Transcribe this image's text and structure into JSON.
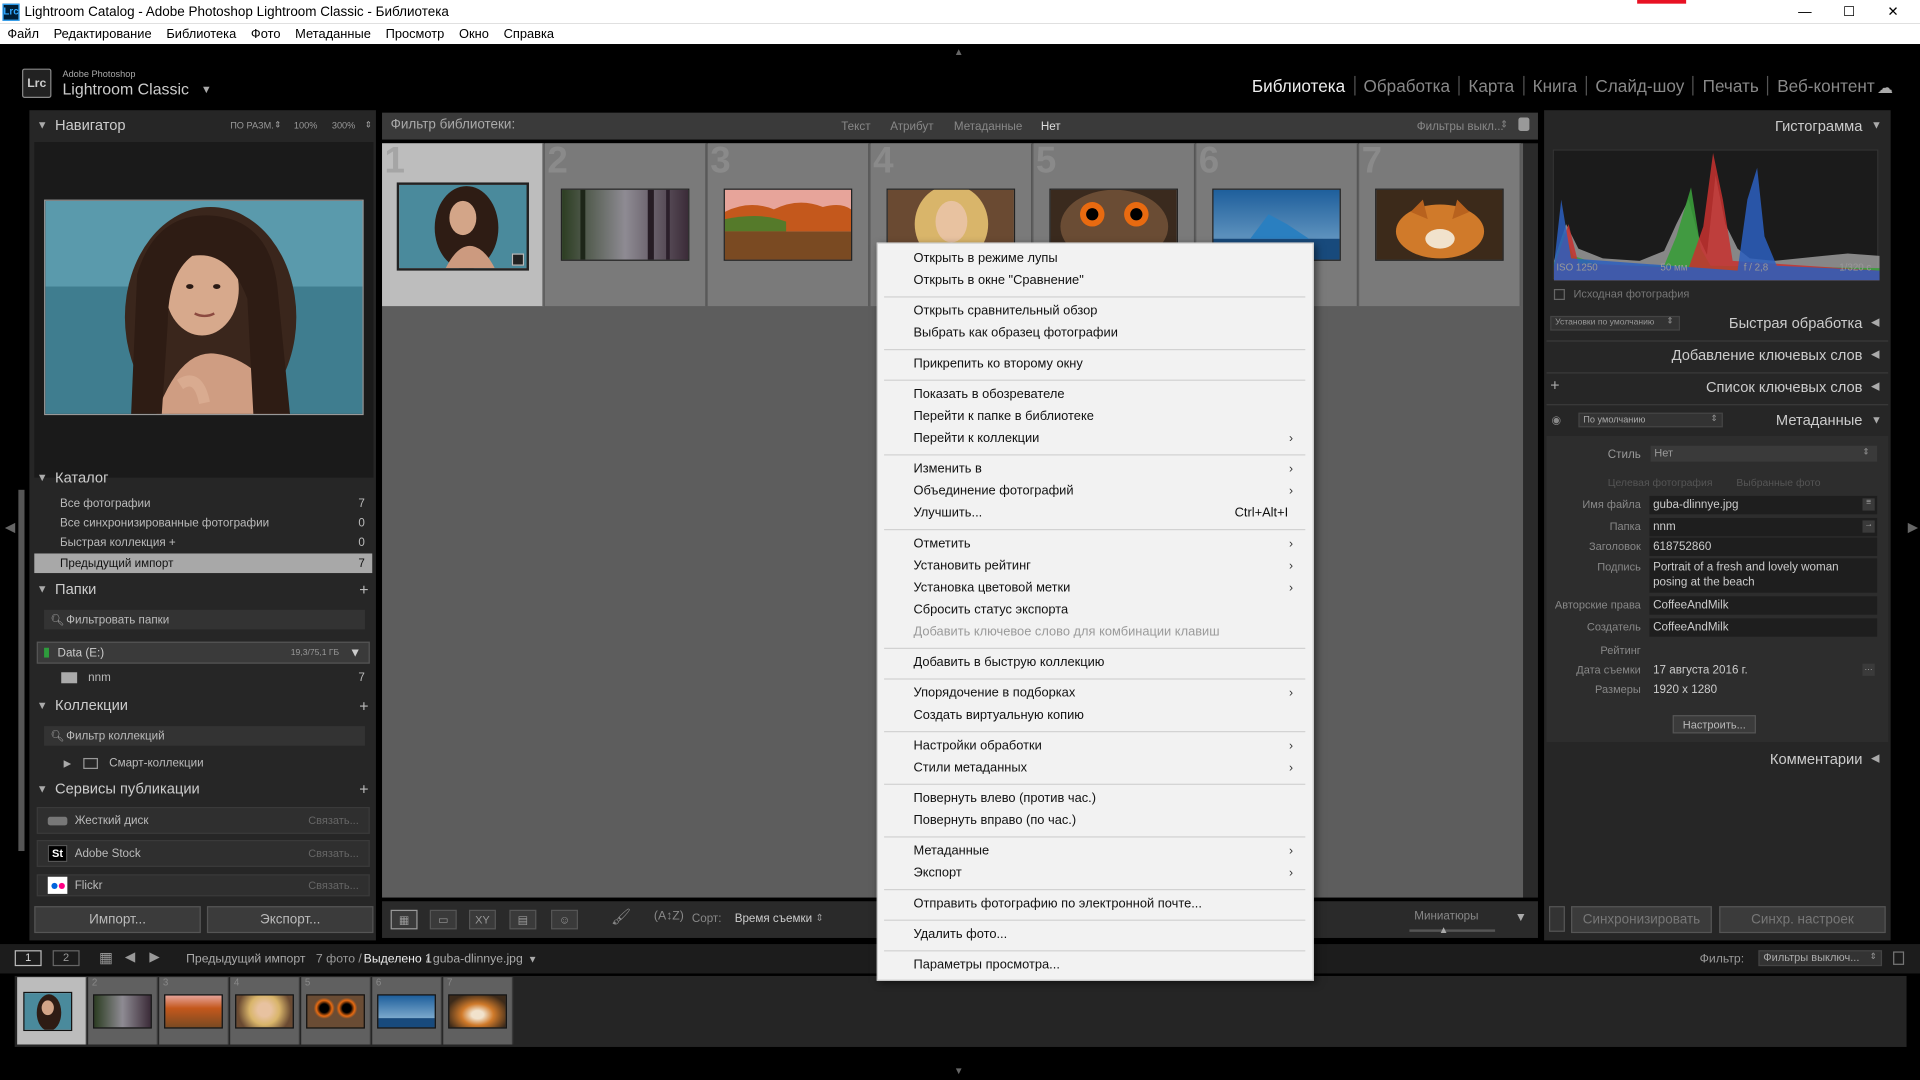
{
  "window": {
    "title": "Lightroom Catalog - Adobe Photoshop Lightroom Classic - Библиотека",
    "icon": "Lrc",
    "controls": [
      "—",
      "☐",
      "✕"
    ]
  },
  "menubar": [
    "Файл",
    "Редактирование",
    "Библиотека",
    "Фото",
    "Метаданные",
    "Просмотр",
    "Окно",
    "Справка"
  ],
  "brand": {
    "small": "Adobe Photoshop",
    "big": "Lightroom Classic",
    "logo": "Lrc"
  },
  "modules": [
    {
      "label": "Библиотека",
      "active": true
    },
    {
      "label": "Обработка"
    },
    {
      "label": "Карта"
    },
    {
      "label": "Книга"
    },
    {
      "label": "Слайд-шоу"
    },
    {
      "label": "Печать"
    },
    {
      "label": "Веб-контент"
    }
  ],
  "navigator": {
    "title": "Навигатор",
    "fit": "ПО РАЗМ.",
    "z1": "100%",
    "z2": "300%"
  },
  "catalog": {
    "title": "Каталог",
    "rows": [
      {
        "label": "Все фотографии",
        "count": "7"
      },
      {
        "label": "Все синхронизированные фотографии",
        "count": "0"
      },
      {
        "label": "Быстрая коллекция  +",
        "count": "0"
      },
      {
        "label": "Предыдущий импорт",
        "count": "7"
      }
    ]
  },
  "folders": {
    "title": "Папки",
    "filter": "Фильтровать папки",
    "volume": "Data (E:)",
    "volume_size": "19,3/75,1 ГБ",
    "folder": "nnm",
    "folder_count": "7"
  },
  "collections": {
    "title": "Коллекции",
    "filter": "Фильтр коллекций",
    "smart": "Смарт-коллекции"
  },
  "publish": {
    "title": "Сервисы публикации",
    "rows": [
      {
        "label": "Жесткий диск",
        "link": "Связать..."
      },
      {
        "label": "Adobe Stock",
        "link": "Связать...",
        "icon": "St"
      },
      {
        "label": "Flickr",
        "link": "Связать..."
      }
    ]
  },
  "left_buttons": {
    "import": "Импорт...",
    "export": "Экспорт..."
  },
  "filterbar": {
    "title": "Фильтр библиотеки:",
    "items": [
      "Текст",
      "Атрибут",
      "Метаданные",
      "Нет"
    ],
    "presets": "Фильтры выкл..."
  },
  "grid": {
    "numbers": [
      "1",
      "2",
      "3",
      "4",
      "5",
      "6",
      "7"
    ]
  },
  "toolbar": {
    "sort_label": "Сорт:",
    "sort_value": "Время съемки",
    "thumbs": "Миниатюры"
  },
  "histogram": {
    "title": "Гистограмма",
    "iso": "ISO 1250",
    "focal": "50 мм",
    "aperture": "f / 2,8",
    "shutter": "1/320 с",
    "original": "Исходная фотография"
  },
  "quick_develop": {
    "title": "Быстрая обработка",
    "preset": "Установки по умолчанию"
  },
  "keywording": {
    "title": "Добавление ключевых слов"
  },
  "keyword_list": {
    "title": "Список ключевых слов"
  },
  "metadata": {
    "title": "Метаданные",
    "preset": "По умолчанию",
    "style_label": "Стиль",
    "style_value": "Нет",
    "target_photo": "Целевая фотография",
    "selected_photos": "Выбранные фото",
    "fields": [
      {
        "label": "Имя файла",
        "value": "guba-dlinnye.jpg"
      },
      {
        "label": "Папка",
        "value": "nnm"
      },
      {
        "label": "Заголовок",
        "value": "618752860"
      },
      {
        "label": "Подпись",
        "value": "Portrait of a fresh and lovely woman posing at the beach"
      },
      {
        "label": "Авторские права",
        "value": "CoffeeAndMilk"
      },
      {
        "label": "Создатель",
        "value": "CoffeeAndMilk"
      },
      {
        "label": "Рейтинг",
        "value": ""
      },
      {
        "label": "Дата съемки",
        "value": "17 августа 2016 г."
      },
      {
        "label": "Размеры",
        "value": "1920 x 1280"
      }
    ],
    "customize": "Настроить..."
  },
  "comments": {
    "title": "Комментарии"
  },
  "right_buttons": {
    "sync": "Синхронизировать",
    "sync_settings": "Синхр. настроек"
  },
  "bottombar": {
    "page1": "1",
    "page2": "2",
    "source": "Предыдущий импорт",
    "photo_count": "7 фото /",
    "selected": "Выделено 1",
    "filename": "/ guba-dlinnye.jpg",
    "filter_label": "Фильтр:",
    "filter_value": "Фильтры выключ..."
  },
  "context_menu": {
    "groups": [
      [
        {
          "label": "Открыть в режиме лупы"
        },
        {
          "label": "Открыть в окне \"Сравнение\""
        }
      ],
      [
        {
          "label": "Открыть сравнительный обзор"
        },
        {
          "label": "Выбрать как образец фотографии"
        }
      ],
      [
        {
          "label": "Прикрепить ко второму окну"
        }
      ],
      [
        {
          "label": "Показать в обозревателе"
        },
        {
          "label": "Перейти к папке в библиотеке"
        },
        {
          "label": "Перейти к коллекции",
          "submenu": true
        }
      ],
      [
        {
          "label": "Изменить в",
          "submenu": true
        },
        {
          "label": "Объединение фотографий",
          "submenu": true
        },
        {
          "label": "Улучшить...",
          "shortcut": "Ctrl+Alt+I"
        }
      ],
      [
        {
          "label": "Отметить",
          "submenu": true
        },
        {
          "label": "Установить рейтинг",
          "submenu": true
        },
        {
          "label": "Установка цветовой метки",
          "submenu": true
        },
        {
          "label": "Сбросить статус экспорта"
        },
        {
          "label": "Добавить ключевое слово для комбинации клавиш",
          "disabled": true
        }
      ],
      [
        {
          "label": "Добавить в быструю коллекцию"
        }
      ],
      [
        {
          "label": "Упорядочение в подборках",
          "submenu": true
        },
        {
          "label": "Создать виртуальную копию"
        }
      ],
      [
        {
          "label": "Настройки обработки",
          "submenu": true
        },
        {
          "label": "Стили метаданных",
          "submenu": true
        }
      ],
      [
        {
          "label": "Повернуть влево (против час.)"
        },
        {
          "label": "Повернуть вправо (по час.)"
        }
      ],
      [
        {
          "label": "Метаданные",
          "submenu": true
        },
        {
          "label": "Экспорт",
          "submenu": true
        }
      ],
      [
        {
          "label": "Отправить фотографию по электронной почте..."
        }
      ],
      [
        {
          "label": "Удалить фото..."
        }
      ],
      [
        {
          "label": "Параметры просмотра..."
        }
      ]
    ]
  },
  "colors": {
    "panel": "#262626",
    "grid_bg": "#5d5d5d",
    "cell": "#7a7a7a",
    "cell_selected": "#bdbdbd",
    "menu_bg": "#f2f2f2",
    "histo_red": "#c8312f",
    "histo_green": "#3a9c3a",
    "histo_blue": "#2b5fc0"
  }
}
